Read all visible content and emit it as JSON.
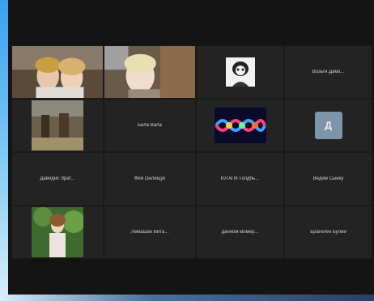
{
  "colors": {
    "tile_bg": "#232323",
    "window_bg": "#141414",
    "initial_bg": "#7d95a8"
  },
  "participants": [
    {
      "kind": "video",
      "name": "",
      "tag": ""
    },
    {
      "kind": "video",
      "name": "",
      "tag": ""
    },
    {
      "kind": "avatar",
      "name": "",
      "tag": ""
    },
    {
      "kind": "name",
      "name": "Возьги Дамз...",
      "tag": ""
    },
    {
      "kind": "video",
      "name": "",
      "tag": ""
    },
    {
      "kind": "name",
      "name": "Бела Вала",
      "tag": ""
    },
    {
      "kind": "video",
      "name": "",
      "tag": ""
    },
    {
      "kind": "initial",
      "name": "Д",
      "tag": ""
    },
    {
      "kind": "name",
      "name": "Давидик Эрат...",
      "tag": ""
    },
    {
      "kind": "name",
      "name": "Фей Онлищук",
      "tag": ""
    },
    {
      "kind": "name",
      "name": "ЮТАПК Голдбь...",
      "tag": ""
    },
    {
      "kind": "name",
      "name": "Ведим Сынку",
      "tag": ""
    },
    {
      "kind": "video",
      "name": "",
      "tag": ""
    },
    {
      "kind": "name",
      "name": "Лемашан Вита...",
      "tag": ""
    },
    {
      "kind": "name",
      "name": "данном момер...",
      "tag": ""
    },
    {
      "kind": "name",
      "name": "Брагелен Булий",
      "tag": ""
    }
  ]
}
